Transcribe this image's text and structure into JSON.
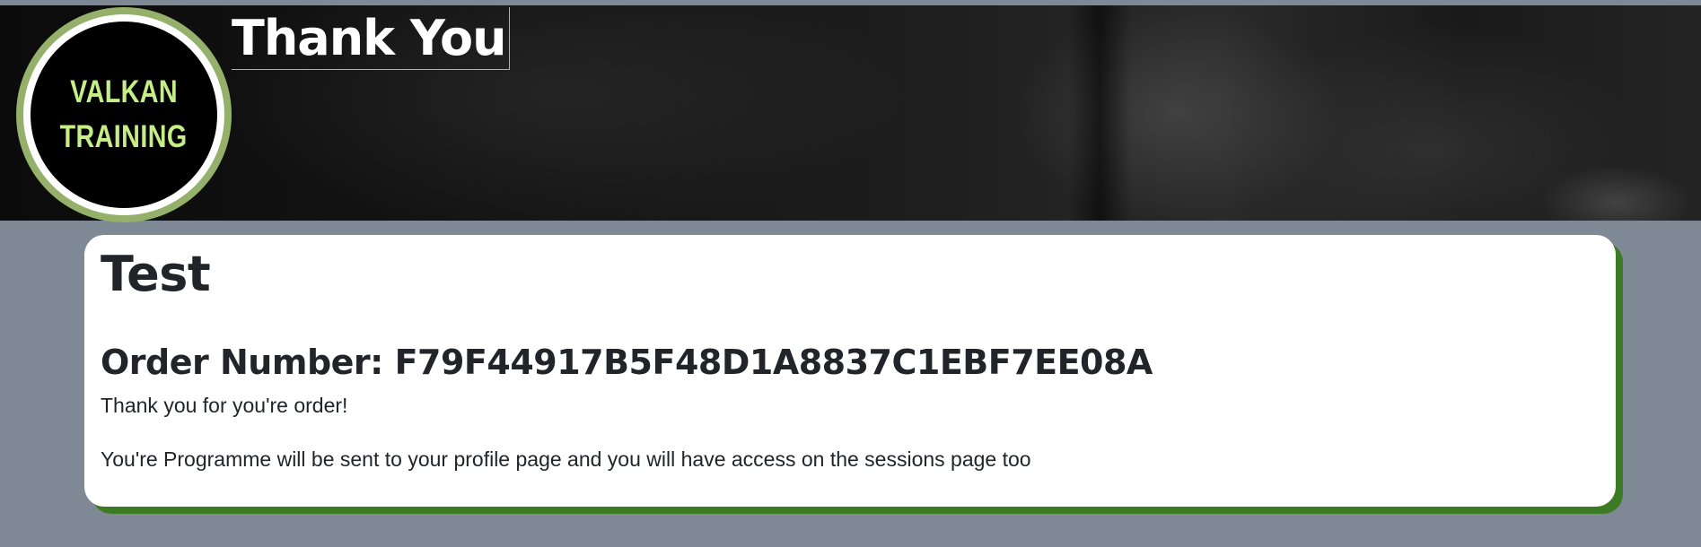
{
  "header": {
    "logo": {
      "line1": "VALKAN",
      "line2": "TRAINING"
    },
    "title": "Thank You"
  },
  "card": {
    "title": "Test",
    "order_label": "Order Number:",
    "order_number": "F79F44917B5F48D1A8837C1EBF7EE08A",
    "message1": "Thank you for you're order!",
    "message2": "You're Programme will be sent to your profile page and you will have access on the sessions page too"
  },
  "colors": {
    "page_background": "#7f8995",
    "logo_ring": "#94b06a",
    "logo_text": "#c7ee86",
    "card_shadow": "#3d7a24",
    "title_border": "#8fd06a"
  }
}
